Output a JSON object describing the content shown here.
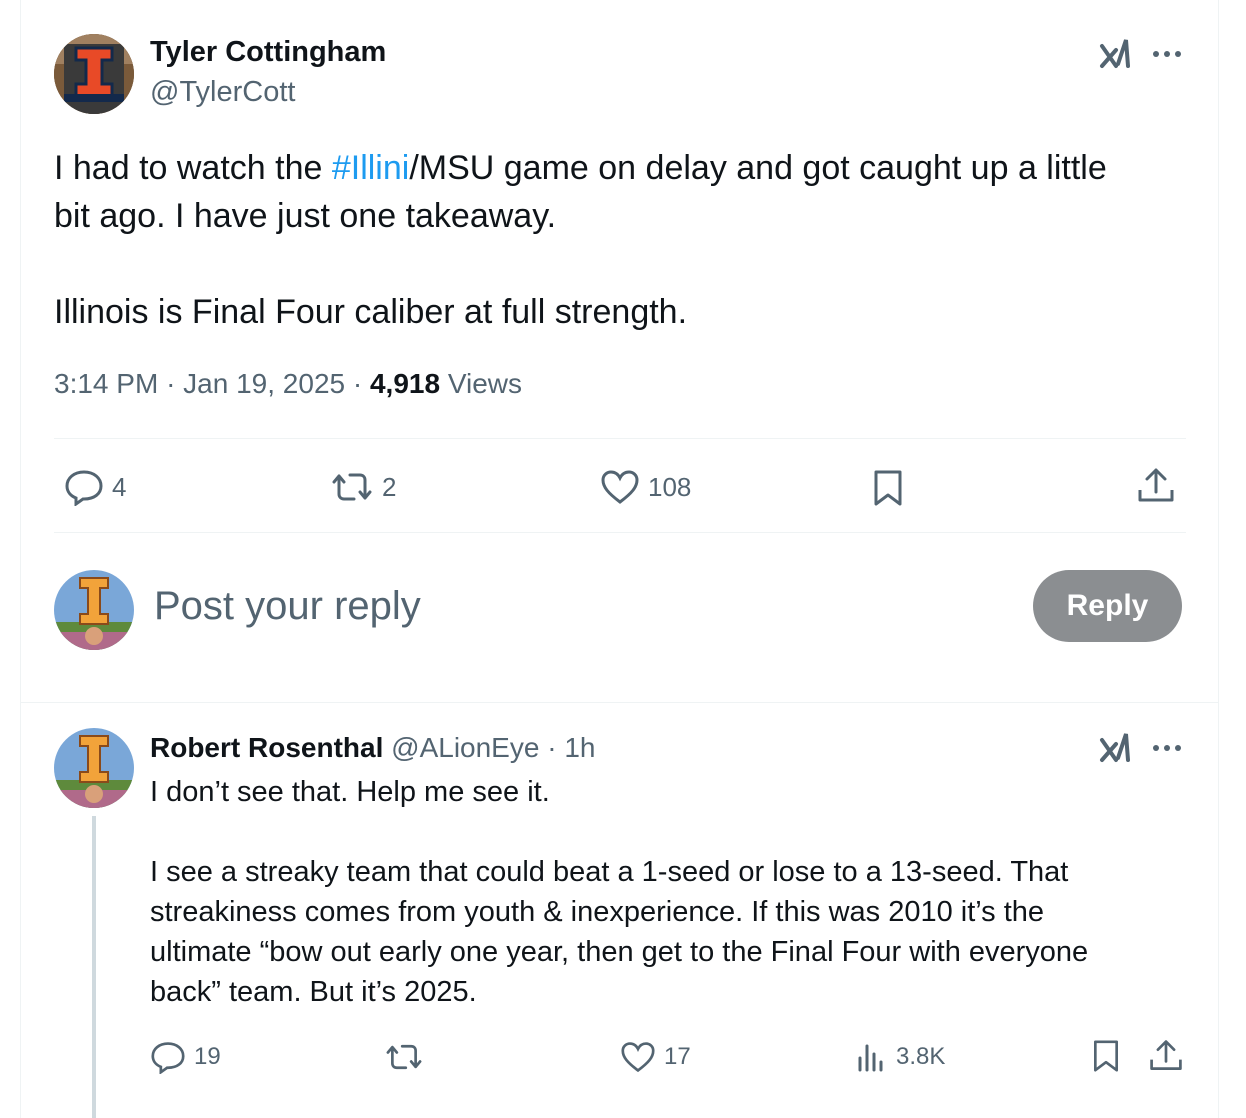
{
  "main_post": {
    "author_name": "Tyler Cottingham",
    "author_handle": "@TylerCott",
    "text_line1_before": "I had to watch the ",
    "hashtag": "#Illini",
    "text_line1_after": "/MSU game on delay and got caught up a little",
    "text_line2": "bit ago.  I have just one takeaway.",
    "text_line3": "Illinois is Final Four caliber at full strength.",
    "time": "3:14 PM",
    "date": "Jan 19, 2025",
    "separator": "·",
    "views_count": "4,918",
    "views_label": "Views",
    "actions": {
      "replies": "4",
      "reposts": "2",
      "likes": "108"
    }
  },
  "reply_box": {
    "placeholder": "Post your reply",
    "button_label": "Reply"
  },
  "reply": {
    "author_name": "Robert Rosenthal",
    "author_handle": "@ALionEye",
    "separator": "·",
    "time": "1h",
    "para1": "I don’t see that. Help me see it.",
    "para2_line1": "I see a streaky team that could beat a 1-seed or lose to a 13-seed. That",
    "para2_line2": "streakiness comes from youth & inexperience. If this was 2010 it’s the",
    "para2_line3": "ultimate “bow out early one year, then get to the Final Four with everyone",
    "para2_line4": "back” team. But it’s 2025.",
    "actions": {
      "replies": "19",
      "likes": "17",
      "views": "3.8K"
    }
  },
  "colors": {
    "accent": "#1d9bf0",
    "muted": "#536471",
    "reply_button_bg": "#8b8e91",
    "divider": "#eff3f4",
    "illini_orange": "#e84a27"
  }
}
